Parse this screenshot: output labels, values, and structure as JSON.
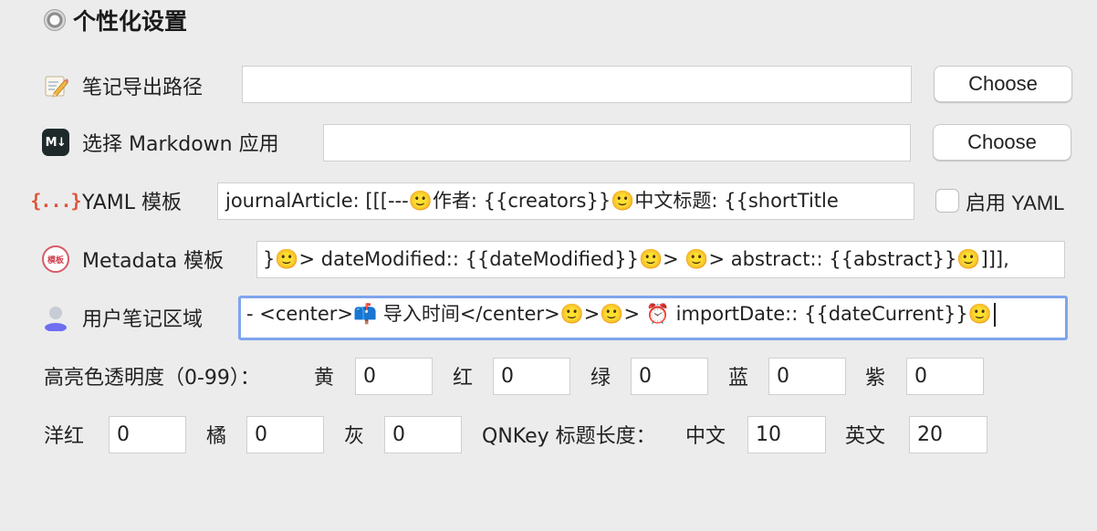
{
  "section": {
    "title": "个性化设置"
  },
  "rows": {
    "export_path": {
      "icon": "memo-icon",
      "label": "笔记导出路径",
      "value": "",
      "button": "Choose"
    },
    "markdown_app": {
      "icon": "markdown-icon",
      "icon_text": "M↓",
      "label": "选择 Markdown 应用",
      "value": "",
      "button": "Choose"
    },
    "yaml_template": {
      "icon": "braces-icon",
      "icon_text": "{...}",
      "label": "YAML 模板",
      "value": "journalArticle: [[[---🙂作者: {{creators}}🙂中文标题: {{shortTitle",
      "checkbox_label": "启用 YAML",
      "checkbox_checked": false
    },
    "metadata_template": {
      "icon": "metadata-icon",
      "icon_text": "模板",
      "label": "Metadata 模板",
      "value": "}🙂> dateModified:: {{dateModified}}🙂> 🙂> abstract:: {{abstract}}🙂]]],"
    },
    "user_notes": {
      "icon": "user-icon",
      "label": "用户笔记区域",
      "value": "- <center>📫 导入时间</center>🙂>🙂> ⏰ importDate:: {{dateCurrent}}🙂"
    }
  },
  "highlight": {
    "label": "高亮色透明度（0-99）：",
    "colors": [
      {
        "label": "黄",
        "value": "0"
      },
      {
        "label": "红",
        "value": "0"
      },
      {
        "label": "绿",
        "value": "0"
      },
      {
        "label": "蓝",
        "value": "0"
      },
      {
        "label": "紫",
        "value": "0"
      },
      {
        "label": "洋红",
        "value": "0"
      },
      {
        "label": "橘",
        "value": "0"
      },
      {
        "label": "灰",
        "value": "0"
      }
    ]
  },
  "qnkey": {
    "label": "QNKey 标题长度：",
    "chinese_label": "中文",
    "chinese_value": "10",
    "english_label": "英文",
    "english_value": "20"
  },
  "colors": {
    "background": "#ececec",
    "focus_ring": "#7ea5ec",
    "yaml_icon": "#e0533a",
    "metadata_icon": "#d85a6a"
  }
}
